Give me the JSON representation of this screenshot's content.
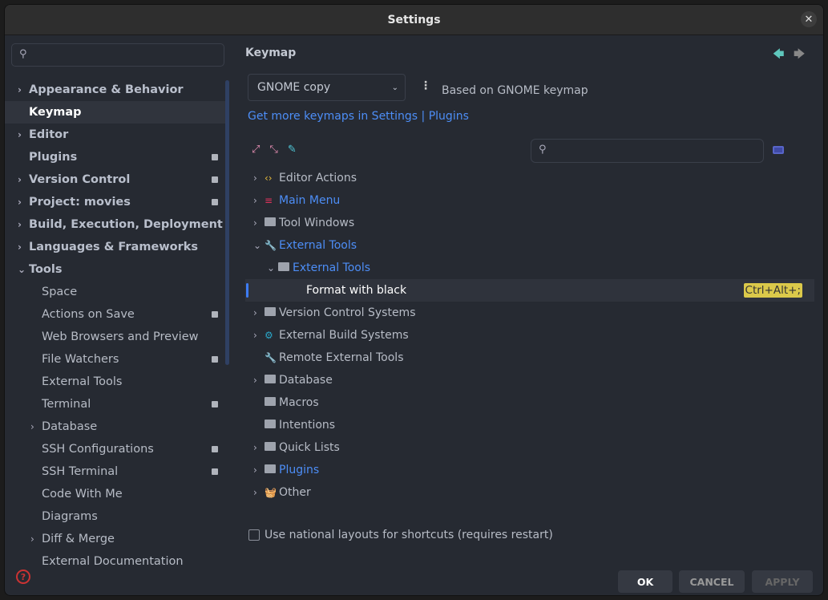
{
  "title": "Settings",
  "sidebar": {
    "search_placeholder": "",
    "items": [
      {
        "label": "Appearance & Behavior",
        "level": 0,
        "chev": true,
        "badge": false
      },
      {
        "label": "Keymap",
        "level": 0,
        "chev": false,
        "badge": false,
        "selected": true
      },
      {
        "label": "Editor",
        "level": 0,
        "chev": true,
        "badge": false
      },
      {
        "label": "Plugins",
        "level": 0,
        "chev": false,
        "badge": true
      },
      {
        "label": "Version Control",
        "level": 0,
        "chev": true,
        "badge": true
      },
      {
        "label": "Project: movies",
        "level": 0,
        "chev": true,
        "badge": true
      },
      {
        "label": "Build, Execution, Deployment",
        "level": 0,
        "chev": true,
        "badge": false
      },
      {
        "label": "Languages & Frameworks",
        "level": 0,
        "chev": true,
        "badge": false
      },
      {
        "label": "Tools",
        "level": 0,
        "chev": "open",
        "badge": false
      },
      {
        "label": "Space",
        "level": 1,
        "chev": false,
        "badge": false
      },
      {
        "label": "Actions on Save",
        "level": 1,
        "chev": false,
        "badge": true
      },
      {
        "label": "Web Browsers and Preview",
        "level": 1,
        "chev": false,
        "badge": false
      },
      {
        "label": "File Watchers",
        "level": 1,
        "chev": false,
        "badge": true
      },
      {
        "label": "External Tools",
        "level": 1,
        "chev": false,
        "badge": false
      },
      {
        "label": "Terminal",
        "level": 1,
        "chev": false,
        "badge": true
      },
      {
        "label": "Database",
        "level": 1,
        "chev": true,
        "badge": false
      },
      {
        "label": "SSH Configurations",
        "level": 1,
        "chev": false,
        "badge": true
      },
      {
        "label": "SSH Terminal",
        "level": 1,
        "chev": false,
        "badge": true
      },
      {
        "label": "Code With Me",
        "level": 1,
        "chev": false,
        "badge": false
      },
      {
        "label": "Diagrams",
        "level": 1,
        "chev": false,
        "badge": false
      },
      {
        "label": "Diff & Merge",
        "level": 1,
        "chev": true,
        "badge": false
      },
      {
        "label": "External Documentation",
        "level": 1,
        "chev": false,
        "badge": false
      }
    ]
  },
  "main": {
    "heading": "Keymap",
    "keymap_select": "GNOME copy",
    "based_on": "Based on GNOME keymap",
    "link": "Get more keymaps in Settings | Plugins",
    "tree": [
      {
        "label": "Editor Actions",
        "level": 0,
        "chev": ">",
        "icon": "code-icon",
        "blue": false
      },
      {
        "label": "Main Menu",
        "level": 0,
        "chev": ">",
        "icon": "menu-icon",
        "blue": true
      },
      {
        "label": "Tool Windows",
        "level": 0,
        "chev": ">",
        "icon": "folder-icon",
        "blue": false
      },
      {
        "label": "External Tools",
        "level": 0,
        "chev": "v",
        "icon": "wrench-icon",
        "blue": true
      },
      {
        "label": "External Tools",
        "level": 1,
        "chev": "v",
        "icon": "folder-icon",
        "blue": true
      },
      {
        "label": "Format with black",
        "level": 2,
        "chev": "",
        "icon": "",
        "blue": false,
        "selected": true,
        "shortcut": "Ctrl+Alt+;"
      },
      {
        "label": "Version Control Systems",
        "level": 0,
        "chev": ">",
        "icon": "folder-icon",
        "blue": false
      },
      {
        "label": "External Build Systems",
        "level": 0,
        "chev": ">",
        "icon": "build-folder-icon",
        "blue": false
      },
      {
        "label": "Remote External Tools",
        "level": 0,
        "chev": "",
        "icon": "wrench-icon",
        "blue": false
      },
      {
        "label": "Database",
        "level": 0,
        "chev": ">",
        "icon": "folder-icon",
        "blue": false
      },
      {
        "label": "Macros",
        "level": 0,
        "chev": "",
        "icon": "folder-icon",
        "blue": false
      },
      {
        "label": "Intentions",
        "level": 0,
        "chev": "",
        "icon": "folder-icon",
        "blue": false
      },
      {
        "label": "Quick Lists",
        "level": 0,
        "chev": ">",
        "icon": "folder-icon",
        "blue": false
      },
      {
        "label": "Plugins",
        "level": 0,
        "chev": ">",
        "icon": "folder-icon",
        "blue": true
      },
      {
        "label": "Other",
        "level": 0,
        "chev": ">",
        "icon": "basket-icon",
        "blue": false
      }
    ],
    "checkbox_label": "Use national layouts for shortcuts (requires restart)"
  },
  "buttons": {
    "ok": "OK",
    "cancel": "CANCEL",
    "apply": "APPLY"
  },
  "colors": {
    "accent": "#4d8ef7",
    "shortcut_bg": "#dbc94a",
    "background": "#262a32"
  }
}
